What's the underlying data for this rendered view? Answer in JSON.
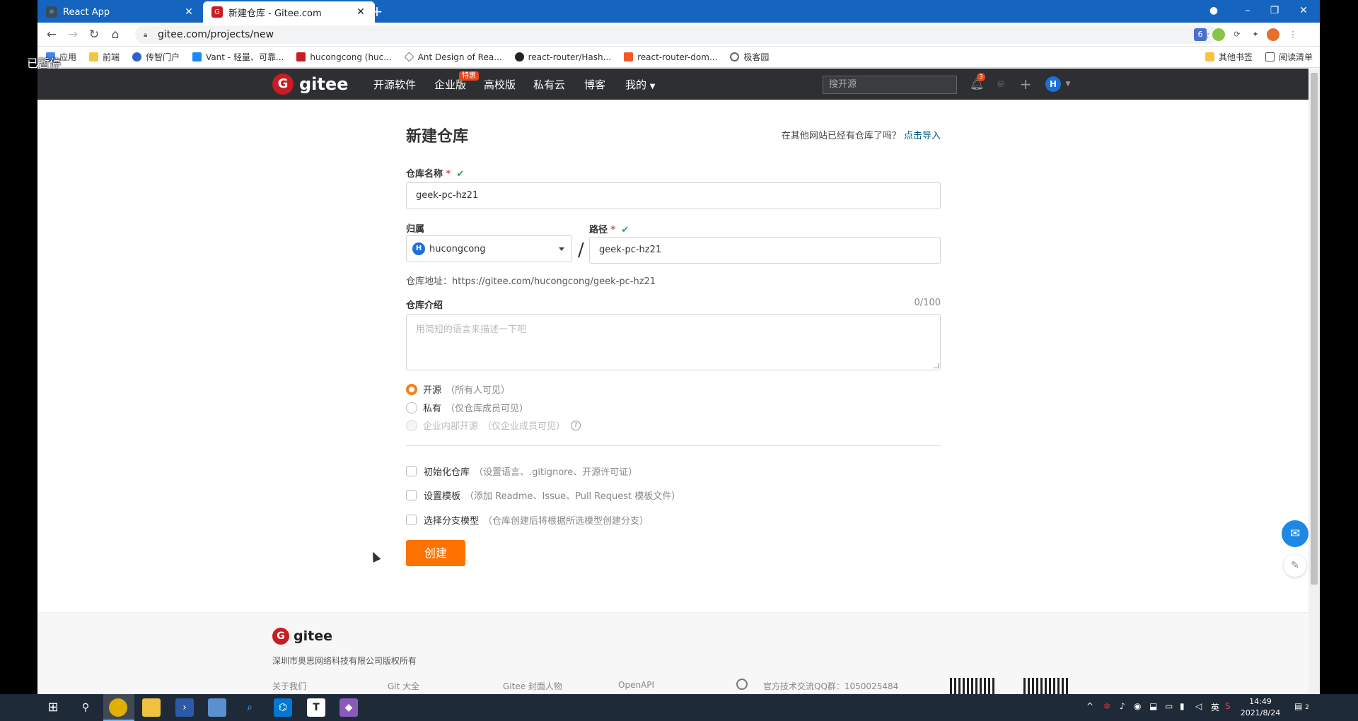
{
  "screen": {
    "paused_label": "已暂停"
  },
  "browser": {
    "tabs": [
      {
        "title": "React App",
        "active": false
      },
      {
        "title": "新建仓库 - Gitee.com",
        "active": true
      }
    ],
    "url": "gitee.com/projects/new",
    "extension_badge": "6",
    "bookmarks": [
      "应用",
      "前端",
      "传智门户",
      "Vant - 轻量、可靠...",
      "hucongcong (huc...",
      "Ant Design of Rea...",
      "react-router/Hash...",
      "react-router-dom...",
      "极客园"
    ],
    "bookmarks_right": [
      "其他书签",
      "阅读清单"
    ]
  },
  "gitee_nav": {
    "logo": "gitee",
    "menu": [
      "开源软件",
      "企业版",
      "高校版",
      "私有云",
      "博客",
      "我的"
    ],
    "enterprise_badge": "特惠",
    "search_placeholder": "搜开源",
    "notification_count": "3",
    "avatar_letter": "H"
  },
  "form": {
    "title": "新建仓库",
    "import_prompt": "在其他网站已经有仓库了吗？",
    "import_link": "点击导入",
    "name_label": "仓库名称",
    "name_value": "geek-pc-hz21",
    "owner_label": "归属",
    "owner_value": "hucongcong",
    "owner_avatar": "H",
    "path_label": "路径",
    "path_value": "geek-pc-hz21",
    "repo_address_label": "仓库地址：",
    "repo_address": "https://gitee.com/hucongcong/geek-pc-hz21",
    "intro_label": "仓库介绍",
    "intro_counter": "0/100",
    "intro_placeholder": "用简短的语言来描述一下吧",
    "visibility": [
      {
        "label": "开源",
        "note": "（所有人可见）",
        "checked": true,
        "disabled": false
      },
      {
        "label": "私有",
        "note": "（仅仓库成员可见）",
        "checked": false,
        "disabled": false
      },
      {
        "label": "企业内部开源",
        "note": "（仅企业成员可见）",
        "checked": false,
        "disabled": true
      }
    ],
    "options": [
      {
        "label": "初始化仓库",
        "note": "（设置语言、.gitignore、开源许可证）"
      },
      {
        "label": "设置模板",
        "note": "（添加 Readme、Issue、Pull Request 模板文件）"
      },
      {
        "label": "选择分支模型",
        "note": "（仓库创建后将根据所选模型创建分支）"
      }
    ],
    "create_button": "创建"
  },
  "footer": {
    "logo": "gitee",
    "copyright": "深圳市奥思网络科技有限公司版权所有",
    "links": [
      "关于我们",
      "Git 大全",
      "Gitee 封面人物",
      "OpenAPI"
    ],
    "qq_group": "官方技术交流QQ群：1050025484"
  },
  "taskbar": {
    "time": "14:49",
    "date": "2021/8/24",
    "ime": "英",
    "notification_count": "2"
  }
}
